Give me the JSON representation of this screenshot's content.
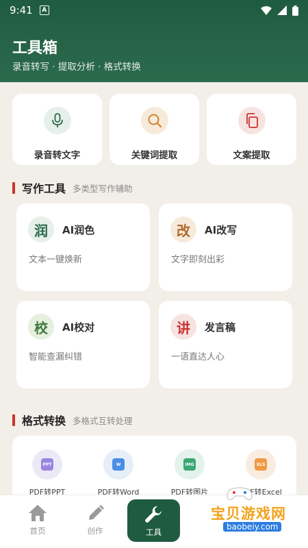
{
  "status": {
    "time": "9:41",
    "notice": "A"
  },
  "header": {
    "title": "工具箱",
    "subtitle": "录音转写 · 提取分析 · 格式转换"
  },
  "quick_actions": [
    {
      "label": "录音转文字",
      "icon": "microphone-icon",
      "color": "#2c6a4d",
      "bg": "#e6efe9"
    },
    {
      "label": "关键词提取",
      "icon": "search-icon",
      "color": "#d08530",
      "bg": "#f6eadb"
    },
    {
      "label": "文案提取",
      "icon": "copy-icon",
      "color": "#c9342f",
      "bg": "#f7e3e2"
    }
  ],
  "writing": {
    "title": "写作工具",
    "subtitle": "多类型写作辅助",
    "tools": [
      {
        "glyph": "润",
        "name": "AI润色",
        "desc": "文本一键焕新",
        "color": "#2c6a4d",
        "bg": "#e6efe9"
      },
      {
        "glyph": "改",
        "name": "AI改写",
        "desc": "文字即刻出彩",
        "color": "#b06a2a",
        "bg": "#f6eadb"
      },
      {
        "glyph": "校",
        "name": "AI校对",
        "desc": "智能查漏纠错",
        "color": "#3c7a3c",
        "bg": "#e7efdf"
      },
      {
        "glyph": "讲",
        "name": "发言稿",
        "desc": "一语直达人心",
        "color": "#c9342f",
        "bg": "#f7e3e2"
      }
    ]
  },
  "format": {
    "title": "格式转换",
    "subtitle": "多格式互转处理",
    "items": [
      {
        "label": "PDF转PPT",
        "tile": "PPT",
        "tile_color": "#9a86e0",
        "bg": "#ece9f7"
      },
      {
        "label": "PDF转Word",
        "tile": "W",
        "tile_color": "#4a8ee6",
        "bg": "#e6eef8"
      },
      {
        "label": "PDF转图片",
        "tile": "IMG",
        "tile_color": "#3aa972",
        "bg": "#e3f2ea"
      },
      {
        "label": "PDF转Excel",
        "tile": "XLS",
        "tile_color": "#ee9a42",
        "bg": "#f9ece0"
      }
    ]
  },
  "nav": [
    {
      "label": "首页",
      "icon": "home-icon"
    },
    {
      "label": "创作",
      "icon": "pencil-icon"
    },
    {
      "label": "工具",
      "icon": "wrench-icon",
      "active": true
    }
  ],
  "watermark": {
    "text": "宝贝游戏网",
    "url": "baobeiy.com"
  }
}
